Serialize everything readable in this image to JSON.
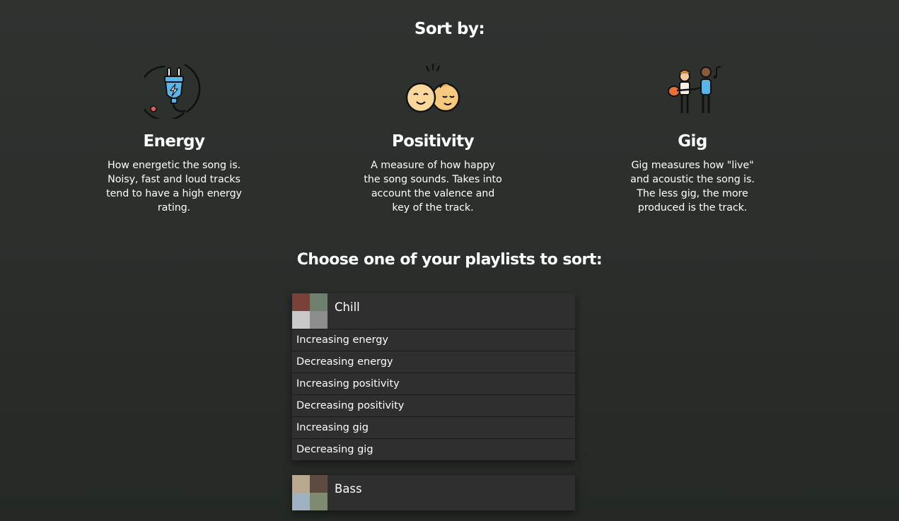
{
  "headings": {
    "sort_by": "Sort by:",
    "choose": "Choose one of your playlists to sort:"
  },
  "features": [
    {
      "icon": "power-plug-icon",
      "title": "Energy",
      "description": "How energetic the song is. Noisy, fast and loud tracks tend to have a high energy rating."
    },
    {
      "icon": "happy-faces-icon",
      "title": "Positivity",
      "description": "A measure of how happy the song sounds. Takes into account the valence and key of the track."
    },
    {
      "icon": "musicians-icon",
      "title": "Gig",
      "description": "Gig measures how \"live\" and acoustic the song is. The less gig, the more produced is the track."
    }
  ],
  "playlists": [
    {
      "name": "Chill",
      "cover_colors": [
        "#7a3f37",
        "#6f7f6d",
        "#c9c9c9",
        "#8d8d8d"
      ],
      "options": [
        "Increasing energy",
        "Decreasing energy",
        "Increasing positivity",
        "Decreasing positivity",
        "Increasing gig",
        "Decreasing gig"
      ]
    },
    {
      "name": "Bass",
      "cover_colors": [
        "#b8a98e",
        "#5d4a40",
        "#9fb2c3",
        "#7f8b70"
      ]
    }
  ],
  "colors": {
    "background": "#2b2f2c",
    "card": "#2f2f2f",
    "text": "#ffffff"
  }
}
